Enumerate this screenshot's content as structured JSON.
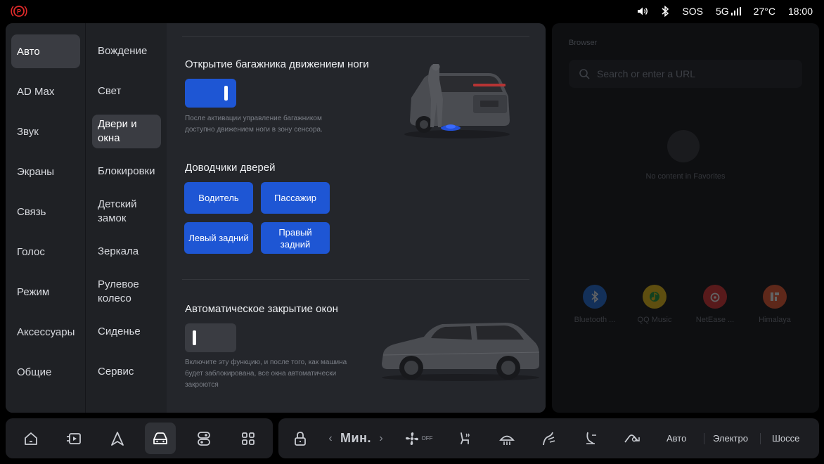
{
  "status": {
    "sos": "SOS",
    "network": "5G",
    "temperature": "27°C",
    "time": "18:00"
  },
  "nav_primary": [
    "Авто",
    "AD Max",
    "Звук",
    "Экраны",
    "Связь",
    "Голос",
    "Режим",
    "Аксессуары",
    "Общие"
  ],
  "nav_secondary": [
    "Вождение",
    "Свет",
    "Двери и окна",
    "Блокировки",
    "Детский замок",
    "Зеркала",
    "Рулевое колесо",
    "Сиденье",
    "Сервис"
  ],
  "trunk": {
    "title": "Открытие багажника движением ноги",
    "hint": "После активации управление багажником доступно движением ноги в зону сенсора.",
    "enabled": true
  },
  "door_closers": {
    "title": "Доводчики дверей",
    "buttons": [
      "Водитель",
      "Пассажир",
      "Левый задний",
      "Правый задний"
    ]
  },
  "auto_windows": {
    "title": "Автоматическое закрытие окон",
    "hint": "Включите эту функцию, и после того, как машина будет заблокирована, все окна автоматически закроются",
    "enabled": false
  },
  "browser": {
    "title": "Browser",
    "search_placeholder": "Search or enter a URL",
    "empty_text": "No content in Favorites",
    "apps": [
      "Bluetooth ...",
      "QQ Music",
      "NetEase ...",
      "Himalaya"
    ]
  },
  "dock": {
    "fan_label": "Мин.",
    "fan_off": "OFF",
    "modes": [
      "Авто",
      "Электро",
      "Шоссе"
    ]
  },
  "colors": {
    "accent": "#1e56d4",
    "panel": "#24262b",
    "sidebar": "#1f2125"
  }
}
